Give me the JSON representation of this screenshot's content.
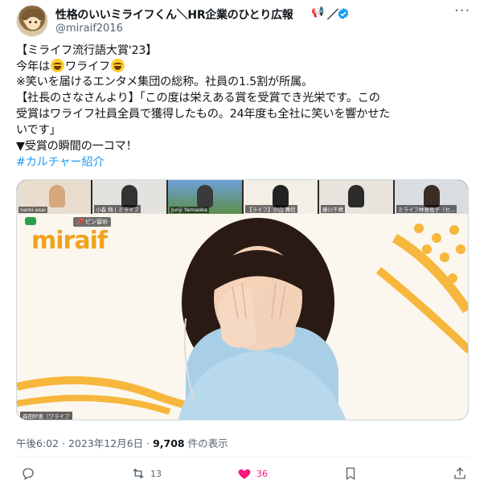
{
  "author": {
    "display_name": "性格のいいミライフくん＼HR企業のひとり広報",
    "name_suffix_slash": "／",
    "handle": "@miraif2016",
    "verified": true,
    "verified_color": "#1d9bf0"
  },
  "tweet": {
    "lines": [
      "【ミライフ流行語大賞'23】",
      "※笑いを届けるエンタメ集団の総称。社員の1.5割が所属。",
      "【社長のさなさんより】「この度は栄えある賞を受賞でき光栄です。この",
      "受賞はワライフ社員全員で獲得したもの。24年度も全社に笑いを響かせた",
      "いです」",
      "▼受賞の瞬間の一コマ！"
    ],
    "line2_prefix": "今年は",
    "line2_middle": "ワライフ",
    "hashtag": "#カルチャー紹介"
  },
  "media": {
    "participants": [
      "nami-asai",
      "小森 翔 | ミライフ",
      "Junji Yamaoka",
      "【ライフ】小山 舞信",
      "藤川千晴",
      "ミライフ林島佑子（セ..."
    ],
    "pinned_label": "ピン留め",
    "stage_logo": "miraif",
    "stage_name_label": "森田紗恵（ワライフ"
  },
  "meta": {
    "time": "午後6:02 · 2023年12月6日 · ",
    "views": "9,708",
    "views_suffix": " 件の表示"
  },
  "actions": {
    "retweets": "13",
    "likes": "36",
    "like_color": "#f91880"
  }
}
